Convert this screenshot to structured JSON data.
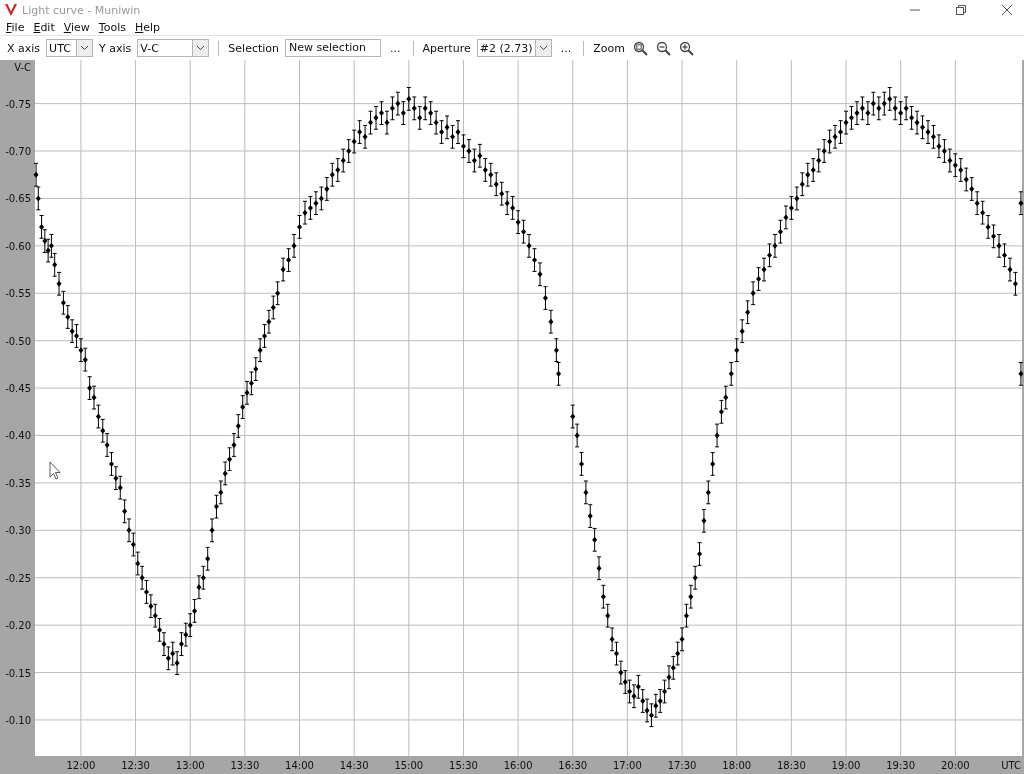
{
  "window": {
    "title": "Light curve - Muniwin"
  },
  "menu": [
    {
      "label": "File"
    },
    {
      "label": "Edit"
    },
    {
      "label": "View"
    },
    {
      "label": "Tools"
    },
    {
      "label": "Help"
    }
  ],
  "toolbar": {
    "x_axis": {
      "label": "X axis",
      "value": "UTC"
    },
    "y_axis": {
      "label": "Y axis",
      "value": "V-C"
    },
    "selection": {
      "label": "Selection",
      "value": "New selection",
      "more": "..."
    },
    "aperture": {
      "label": "Aperture",
      "value": "#2 (2.73)",
      "more": "..."
    },
    "zoom": {
      "label": "Zoom"
    }
  },
  "plot": {
    "chart_data": {
      "type": "scatter",
      "grid": true,
      "xlabel": "UTC",
      "ylabel": "V-C",
      "xlim": [
        11.58,
        20.61
      ],
      "ylim": [
        -0.062,
        -0.796
      ],
      "xticks": [
        {
          "value": 12,
          "label": "12:00"
        },
        {
          "value": 12.5,
          "label": "12:30"
        },
        {
          "value": 13,
          "label": "13:00"
        },
        {
          "value": 13.5,
          "label": "13:30"
        },
        {
          "value": 14,
          "label": "14:00"
        },
        {
          "value": 14.5,
          "label": "14:30"
        },
        {
          "value": 15,
          "label": "15:00"
        },
        {
          "value": 15.5,
          "label": "15:30"
        },
        {
          "value": 16,
          "label": "16:00"
        },
        {
          "value": 16.5,
          "label": "16:30"
        },
        {
          "value": 17,
          "label": "17:00"
        },
        {
          "value": 17.5,
          "label": "17:30"
        },
        {
          "value": 18,
          "label": "18:00"
        },
        {
          "value": 18.5,
          "label": "18:30"
        },
        {
          "value": 19,
          "label": "19:00"
        },
        {
          "value": 19.5,
          "label": "19:30"
        },
        {
          "value": 20,
          "label": "20:00"
        }
      ],
      "yticks": [
        {
          "value": -0.75,
          "label": "-0.75"
        },
        {
          "value": -0.7,
          "label": "-0.70"
        },
        {
          "value": -0.65,
          "label": "-0.65"
        },
        {
          "value": -0.6,
          "label": "-0.60"
        },
        {
          "value": -0.55,
          "label": "-0.55"
        },
        {
          "value": -0.5,
          "label": "-0.50"
        },
        {
          "value": -0.45,
          "label": "-0.45"
        },
        {
          "value": -0.4,
          "label": "-0.40"
        },
        {
          "value": -0.35,
          "label": "-0.35"
        },
        {
          "value": -0.3,
          "label": "-0.30"
        },
        {
          "value": -0.25,
          "label": "-0.25"
        },
        {
          "value": -0.2,
          "label": "-0.20"
        },
        {
          "value": -0.15,
          "label": "-0.15"
        },
        {
          "value": -0.1,
          "label": "-0.10"
        }
      ],
      "x": [
        11.59,
        11.61,
        11.64,
        11.67,
        11.7,
        11.73,
        11.76,
        11.8,
        11.84,
        11.88,
        11.92,
        11.96,
        12.0,
        12.04,
        12.08,
        12.12,
        12.16,
        12.2,
        12.24,
        12.28,
        12.32,
        12.36,
        12.4,
        12.44,
        12.48,
        12.52,
        12.56,
        12.6,
        12.64,
        12.68,
        12.72,
        12.76,
        12.8,
        12.84,
        12.88,
        12.92,
        12.96,
        13.0,
        13.04,
        13.08,
        13.12,
        13.16,
        13.2,
        13.24,
        13.28,
        13.32,
        13.36,
        13.4,
        13.44,
        13.48,
        13.52,
        13.56,
        13.6,
        13.64,
        13.68,
        13.72,
        13.76,
        13.8,
        13.85,
        13.9,
        13.95,
        14.0,
        14.05,
        14.1,
        14.15,
        14.2,
        14.25,
        14.3,
        14.35,
        14.4,
        14.45,
        14.5,
        14.55,
        14.6,
        14.65,
        14.7,
        14.75,
        14.8,
        14.85,
        14.9,
        14.95,
        15.0,
        15.05,
        15.1,
        15.15,
        15.2,
        15.25,
        15.3,
        15.35,
        15.4,
        15.45,
        15.5,
        15.55,
        15.6,
        15.65,
        15.7,
        15.75,
        15.8,
        15.85,
        15.9,
        15.95,
        16.0,
        16.05,
        16.1,
        16.15,
        16.2,
        16.25,
        16.3,
        16.35,
        16.37,
        16.5,
        16.54,
        16.58,
        16.62,
        16.66,
        16.7,
        16.74,
        16.78,
        16.82,
        16.86,
        16.9,
        16.94,
        16.98,
        17.02,
        17.06,
        17.1,
        17.14,
        17.18,
        17.22,
        17.26,
        17.3,
        17.34,
        17.38,
        17.42,
        17.46,
        17.5,
        17.54,
        17.58,
        17.62,
        17.66,
        17.7,
        17.74,
        17.78,
        17.82,
        17.86,
        17.9,
        17.95,
        18.0,
        18.05,
        18.1,
        18.15,
        18.2,
        18.25,
        18.3,
        18.35,
        18.4,
        18.45,
        18.5,
        18.55,
        18.6,
        18.65,
        18.7,
        18.75,
        18.8,
        18.85,
        18.9,
        18.95,
        19.0,
        19.05,
        19.1,
        19.15,
        19.2,
        19.25,
        19.3,
        19.35,
        19.4,
        19.45,
        19.5,
        19.55,
        19.6,
        19.65,
        19.7,
        19.75,
        19.8,
        19.85,
        19.9,
        19.95,
        20.0,
        20.05,
        20.1,
        20.15,
        20.2,
        20.25,
        20.3,
        20.35,
        20.4,
        20.45,
        20.5,
        20.55,
        20.6,
        20.6
      ],
      "series": [
        {
          "color": "#000000",
          "errors": [
            0.012,
            0.012,
            0.012,
            0.012,
            0.012,
            0.012,
            0.012,
            0.012,
            0.012,
            0.012,
            0.012,
            0.012,
            0.012,
            0.012,
            0.012,
            0.012,
            0.012,
            0.012,
            0.012,
            0.012,
            0.012,
            0.012,
            0.012,
            0.012,
            0.012,
            0.012,
            0.012,
            0.012,
            0.012,
            0.012,
            0.012,
            0.012,
            0.012,
            0.012,
            0.012,
            0.012,
            0.012,
            0.012,
            0.012,
            0.012,
            0.012,
            0.012,
            0.012,
            0.012,
            0.012,
            0.012,
            0.012,
            0.012,
            0.012,
            0.012,
            0.012,
            0.012,
            0.012,
            0.012,
            0.012,
            0.012,
            0.012,
            0.012,
            0.012,
            0.012,
            0.012,
            0.012,
            0.012,
            0.012,
            0.012,
            0.012,
            0.012,
            0.012,
            0.012,
            0.012,
            0.012,
            0.012,
            0.012,
            0.012,
            0.012,
            0.012,
            0.012,
            0.012,
            0.012,
            0.012,
            0.012,
            0.012,
            0.012,
            0.012,
            0.012,
            0.012,
            0.012,
            0.012,
            0.012,
            0.012,
            0.012,
            0.012,
            0.012,
            0.012,
            0.012,
            0.012,
            0.012,
            0.012,
            0.012,
            0.012,
            0.012,
            0.012,
            0.012,
            0.012,
            0.012,
            0.012,
            0.012,
            0.012,
            0.012,
            0.012,
            0.012,
            0.012,
            0.012,
            0.012,
            0.012,
            0.012,
            0.012,
            0.012,
            0.012,
            0.012,
            0.012,
            0.012,
            0.012,
            0.012,
            0.012,
            0.012,
            0.012,
            0.012,
            0.012,
            0.012,
            0.012,
            0.012,
            0.012,
            0.012,
            0.012,
            0.012,
            0.012,
            0.012,
            0.012,
            0.012,
            0.012,
            0.012,
            0.012,
            0.012,
            0.012,
            0.012,
            0.012,
            0.012,
            0.012,
            0.012,
            0.012,
            0.012,
            0.012,
            0.012,
            0.012,
            0.012,
            0.012,
            0.012,
            0.012,
            0.012,
            0.012,
            0.012,
            0.012,
            0.012,
            0.012,
            0.012,
            0.012,
            0.012,
            0.012,
            0.012,
            0.012,
            0.012,
            0.012,
            0.012,
            0.012,
            0.012,
            0.012,
            0.012,
            0.012,
            0.012,
            0.012,
            0.012,
            0.012,
            0.012,
            0.012,
            0.012,
            0.012,
            0.012,
            0.012,
            0.012,
            0.012,
            0.012,
            0.012,
            0.012,
            0.012,
            0.012,
            0.012,
            0.012,
            0.012,
            0.012,
            0.012
          ],
          "values": [
            -0.675,
            -0.65,
            -0.62,
            -0.605,
            -0.595,
            -0.6,
            -0.58,
            -0.56,
            -0.54,
            -0.525,
            -0.51,
            -0.505,
            -0.49,
            -0.48,
            -0.45,
            -0.44,
            -0.42,
            -0.405,
            -0.39,
            -0.37,
            -0.355,
            -0.345,
            -0.32,
            -0.3,
            -0.285,
            -0.265,
            -0.25,
            -0.235,
            -0.22,
            -0.21,
            -0.195,
            -0.18,
            -0.165,
            -0.17,
            -0.16,
            -0.18,
            -0.19,
            -0.2,
            -0.215,
            -0.24,
            -0.25,
            -0.27,
            -0.3,
            -0.325,
            -0.34,
            -0.36,
            -0.375,
            -0.39,
            -0.41,
            -0.43,
            -0.445,
            -0.455,
            -0.47,
            -0.49,
            -0.505,
            -0.52,
            -0.535,
            -0.55,
            -0.575,
            -0.585,
            -0.6,
            -0.62,
            -0.635,
            -0.64,
            -0.645,
            -0.65,
            -0.66,
            -0.675,
            -0.68,
            -0.69,
            -0.7,
            -0.71,
            -0.72,
            -0.715,
            -0.73,
            -0.735,
            -0.74,
            -0.73,
            -0.745,
            -0.75,
            -0.74,
            -0.755,
            -0.745,
            -0.735,
            -0.745,
            -0.74,
            -0.73,
            -0.72,
            -0.725,
            -0.715,
            -0.72,
            -0.705,
            -0.7,
            -0.69,
            -0.695,
            -0.68,
            -0.675,
            -0.665,
            -0.655,
            -0.645,
            -0.64,
            -0.625,
            -0.615,
            -0.6,
            -0.585,
            -0.57,
            -0.545,
            -0.52,
            -0.49,
            -0.465,
            -0.42,
            -0.4,
            -0.37,
            -0.34,
            -0.315,
            -0.29,
            -0.26,
            -0.23,
            -0.21,
            -0.185,
            -0.17,
            -0.15,
            -0.14,
            -0.13,
            -0.125,
            -0.135,
            -0.12,
            -0.11,
            -0.105,
            -0.115,
            -0.12,
            -0.13,
            -0.145,
            -0.155,
            -0.17,
            -0.185,
            -0.21,
            -0.23,
            -0.25,
            -0.275,
            -0.31,
            -0.34,
            -0.37,
            -0.4,
            -0.425,
            -0.44,
            -0.465,
            -0.49,
            -0.51,
            -0.53,
            -0.55,
            -0.565,
            -0.575,
            -0.59,
            -0.6,
            -0.615,
            -0.63,
            -0.64,
            -0.65,
            -0.665,
            -0.675,
            -0.68,
            -0.69,
            -0.7,
            -0.71,
            -0.715,
            -0.72,
            -0.73,
            -0.735,
            -0.74,
            -0.745,
            -0.74,
            -0.75,
            -0.745,
            -0.75,
            -0.755,
            -0.745,
            -0.74,
            -0.745,
            -0.735,
            -0.73,
            -0.725,
            -0.72,
            -0.715,
            -0.705,
            -0.7,
            -0.69,
            -0.685,
            -0.68,
            -0.67,
            -0.66,
            -0.645,
            -0.635,
            -0.62,
            -0.61,
            -0.6,
            -0.59,
            -0.575,
            -0.56,
            -0.645,
            -0.465
          ]
        }
      ]
    }
  }
}
